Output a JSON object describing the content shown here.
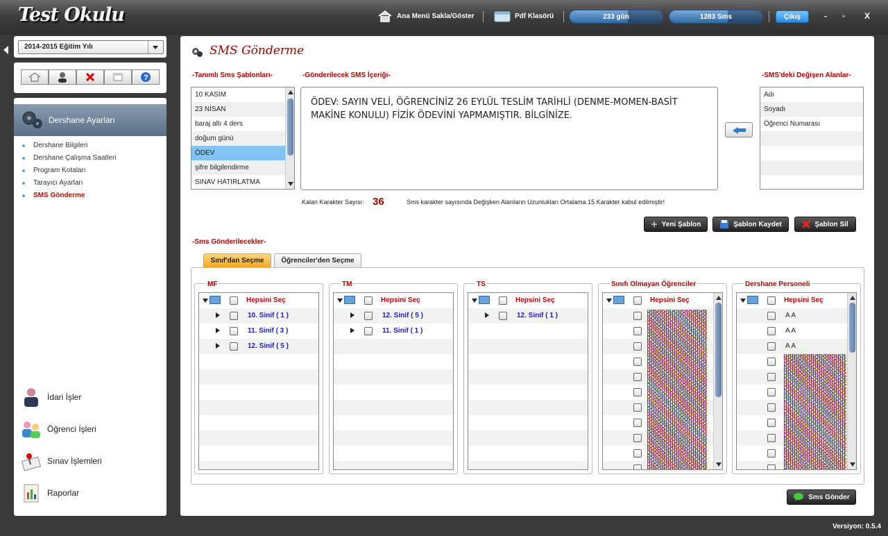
{
  "app": {
    "title": "Test Okulu",
    "version": "Versiyon: 0.5.4"
  },
  "topbar": {
    "menu_toggle": "Ana Menü Sakla/Göster",
    "pdf": "Pdf Klasörü",
    "days": "233 gün",
    "sms": "1283 Sms",
    "exit": "Çıkış",
    "min": "-",
    "max": "▫",
    "close": "X"
  },
  "sidebar": {
    "year": "2014-2015 Eğitim Yılı",
    "header": "Dershane Ayarları",
    "items": [
      "Dershane Bilgileri",
      "Dershane Çalışma Saatleri",
      "Program Kotaları",
      "Tarayıcı Ayarları",
      "SMS Gönderme"
    ],
    "modules": [
      "İdari İşler",
      "Öğrenci İşleri",
      "Sınav İşlemleri",
      "Raporlar"
    ]
  },
  "main": {
    "title": "SMS Gönderme",
    "templates_label": "-Tanımlı Sms Şablonları-",
    "templates": [
      "10 KASIM",
      "23 NİSAN",
      "baraj altı 4 ders",
      "doğum günü",
      "ÖDEV",
      "şifre bilgilendirme",
      "SINAV HATIRLATMA"
    ],
    "content_label": "-Gönderilecek SMS İçeriği-",
    "content": "ÖDEV: SAYIN VELİ, ÖĞRENCİNİZ 26 EYLÜL TESLİM TARİHLİ (DENME-MOMEN-BASİT MAKİNE KONULU) FİZİK ÖDEVİNİ YAPMAMIŞTIR. BİLGİNİZE.",
    "fields_label": "-SMS'deki Değişen Alanlar-",
    "fields": [
      "Adı",
      "Soyadı",
      "Öğrenci Numarası"
    ],
    "remaining_label": "Kalan Karakter Sayısı:",
    "remaining": "36",
    "note": "Sms karakter sayısında Değişken Alanların Uzunlukları Ortalama 15 Karakter kabul edilmiştir!",
    "btn_new": "Yeni Şablon",
    "btn_save": "Şablon Kaydet",
    "btn_delete": "Şablon Sil",
    "recipients_label": "-Sms Gönderilecekler-",
    "tab_class": "Sınıf'dan Seçme",
    "tab_students": "Öğrenciler'den Seçme",
    "select_all": "Hepsini Seç",
    "groups": [
      {
        "title": "MF",
        "items": [
          "10. Sinif ( 1 )",
          "11. Sinif ( 3 )",
          "12. Sinif ( 5 )"
        ]
      },
      {
        "title": "TM",
        "items": [
          "12. Sinif ( 5 )",
          "11. Sinif ( 1 )"
        ]
      },
      {
        "title": "TS",
        "items": [
          "12. Sinif ( 1 )"
        ]
      },
      {
        "title": "Sınıfı Olmayan Öğrenciler",
        "items": []
      },
      {
        "title": "Dershane Personeli",
        "items": [
          "A A",
          "A A",
          "A A"
        ]
      }
    ],
    "send": "Sms Gönder"
  }
}
